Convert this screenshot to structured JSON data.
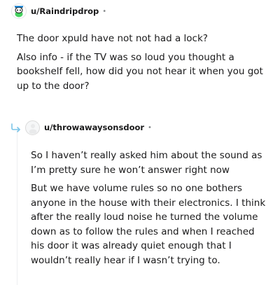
{
  "comments": [
    {
      "username": "u/Raindripdrop",
      "separator": "•",
      "avatar_icon": "snoo-avatar-icon",
      "paragraphs": [
        "The door xpuld have not not had a lock?",
        "Also info - if the TV was so loud you thought a bookshelf fell, how did you not hear it when you got up to the door?"
      ]
    },
    {
      "username": "u/throwawaysonsdoor",
      "separator": "•",
      "avatar_icon": "default-avatar-icon",
      "reply_icon": "reply-arrow-icon",
      "paragraphs": [
        "So I haven’t really asked him about the sound as I’m pretty sure he won’t answer right now",
        "But we have volume rules so no one bothers anyone in the house with their electronics. I think after the really loud noise he turned the volume down as to follow the rules and when I reached his door it was already quiet enough that I wouldn’t really hear if I wasn’t trying to."
      ]
    }
  ],
  "colors": {
    "text": "#1a1a1b",
    "meta": "#878a8c",
    "reply_arrow": "#7cc5e8",
    "snoo_accent": "#46d160"
  }
}
